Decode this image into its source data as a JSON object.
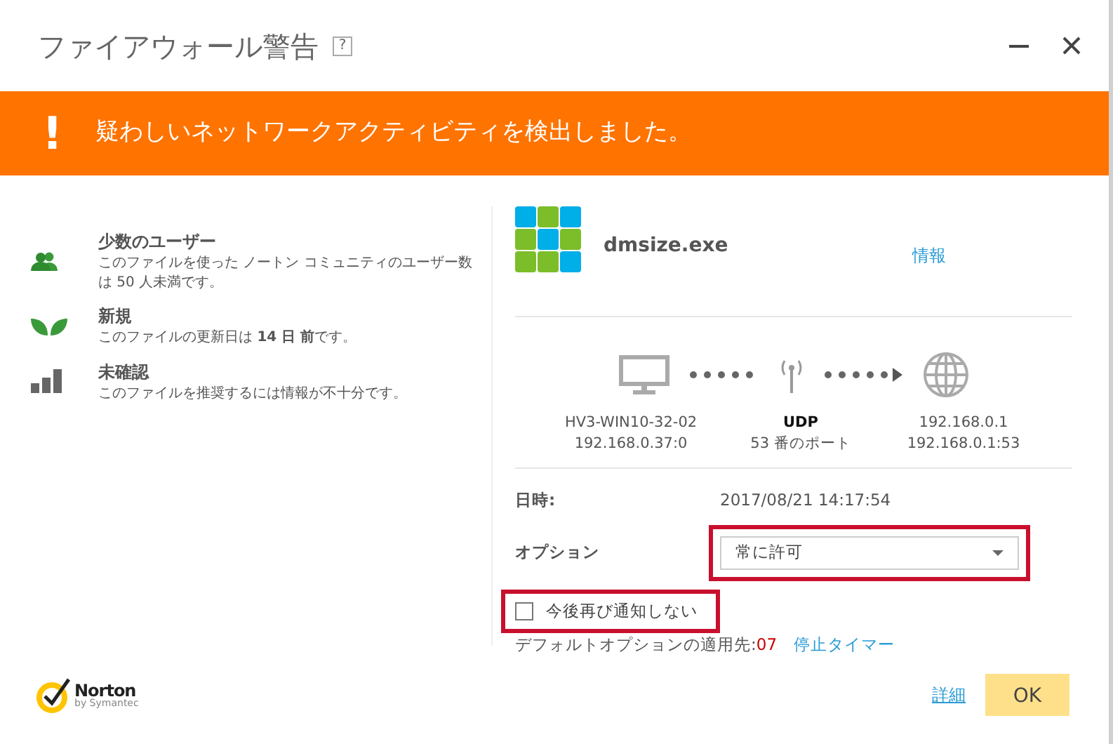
{
  "window": {
    "title": "ファイアウォール警告",
    "help": "?"
  },
  "alert": {
    "icon": "!",
    "message": "疑わしいネットワークアクティビティを検出しました。"
  },
  "reputation": [
    {
      "kind": "users",
      "title": "少数のユーザー",
      "description": "このファイルを使った ノートン コミュニティのユーザー数は 50 人未満です。"
    },
    {
      "kind": "new",
      "title": "新規",
      "description": "このファイルの更新日は **14 日 前**です。"
    },
    {
      "kind": "unknown",
      "title": "未確認",
      "description": "このファイルを推奨するには情報が不十分です。"
    }
  ],
  "file": {
    "name": "dmsize.exe",
    "info_link": "情報"
  },
  "connection": {
    "source": {
      "name": "HV3-WIN10-32-02",
      "address": "192.168.0.37:0"
    },
    "protocol": {
      "name": "UDP",
      "port": "53 番のポート"
    },
    "destination": {
      "name": "192.168.0.1",
      "address": "192.168.0.1:53"
    }
  },
  "details": {
    "time_label": "日時:",
    "time": "2017/08/21 14:17:54",
    "option_label": "オプション",
    "option": "常に許可",
    "option_highlighted": true,
    "dont_notify": {
      "label": "今後再び通知しない",
      "checked": false,
      "highlighted": true
    },
    "default_label": "デフォルトオプションの適用先:",
    "default_value": "07",
    "stop_timer": "停止タイマー"
  },
  "footer": {
    "brand": "Norton",
    "brand_sub": "by Symantec",
    "details_link": "詳細",
    "ok": "OK"
  }
}
